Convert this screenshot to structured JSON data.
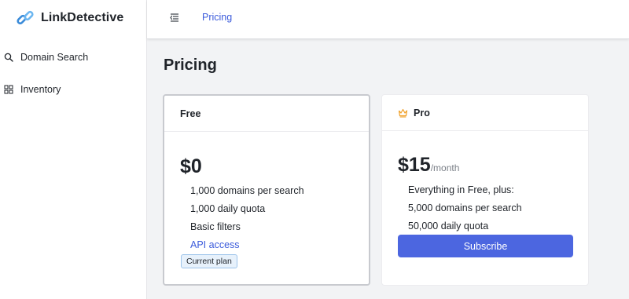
{
  "app": {
    "name": "LinkDetective",
    "logo_icon": "chain-link-icon",
    "accent": "#3b5bdb"
  },
  "sidebar": {
    "items": [
      {
        "label": "Domain Search",
        "icon": "search-icon"
      },
      {
        "label": "Inventory",
        "icon": "grid-icon"
      }
    ]
  },
  "topbar": {
    "breadcrumb": "Pricing",
    "collapse_icon": "menu-collapse-icon"
  },
  "page": {
    "title": "Pricing"
  },
  "plans": [
    {
      "name": "Free",
      "price": "$0",
      "period": "",
      "features": [
        "1,000 domains per search",
        "1,000 daily quota",
        "Basic filters"
      ],
      "link": "API access",
      "badge": "Current plan",
      "current": true
    },
    {
      "name": "Pro",
      "icon": "crown-icon",
      "price": "$15",
      "period": "/month",
      "features": [
        "Everything in Free, plus:",
        "5,000 domains per search",
        "50,000 daily quota"
      ],
      "button": "Subscribe",
      "button_color": "#4c66e0"
    }
  ]
}
